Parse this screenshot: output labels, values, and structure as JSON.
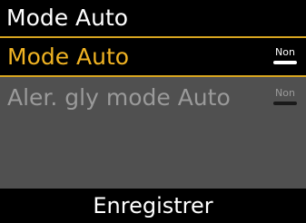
{
  "header": {
    "title": "Mode Auto"
  },
  "menu": {
    "items": [
      {
        "label": "Mode Auto",
        "toggle_value": "Non",
        "state": "selected"
      },
      {
        "label": "Aler. gly mode Auto",
        "toggle_value": "Non",
        "state": "disabled"
      }
    ]
  },
  "footer": {
    "save_label": "Enregistrer"
  },
  "colors": {
    "highlight_text": "#f0b323",
    "highlight_border": "#d8a520",
    "disabled_text": "#9a9a9a",
    "background": "#505050"
  }
}
